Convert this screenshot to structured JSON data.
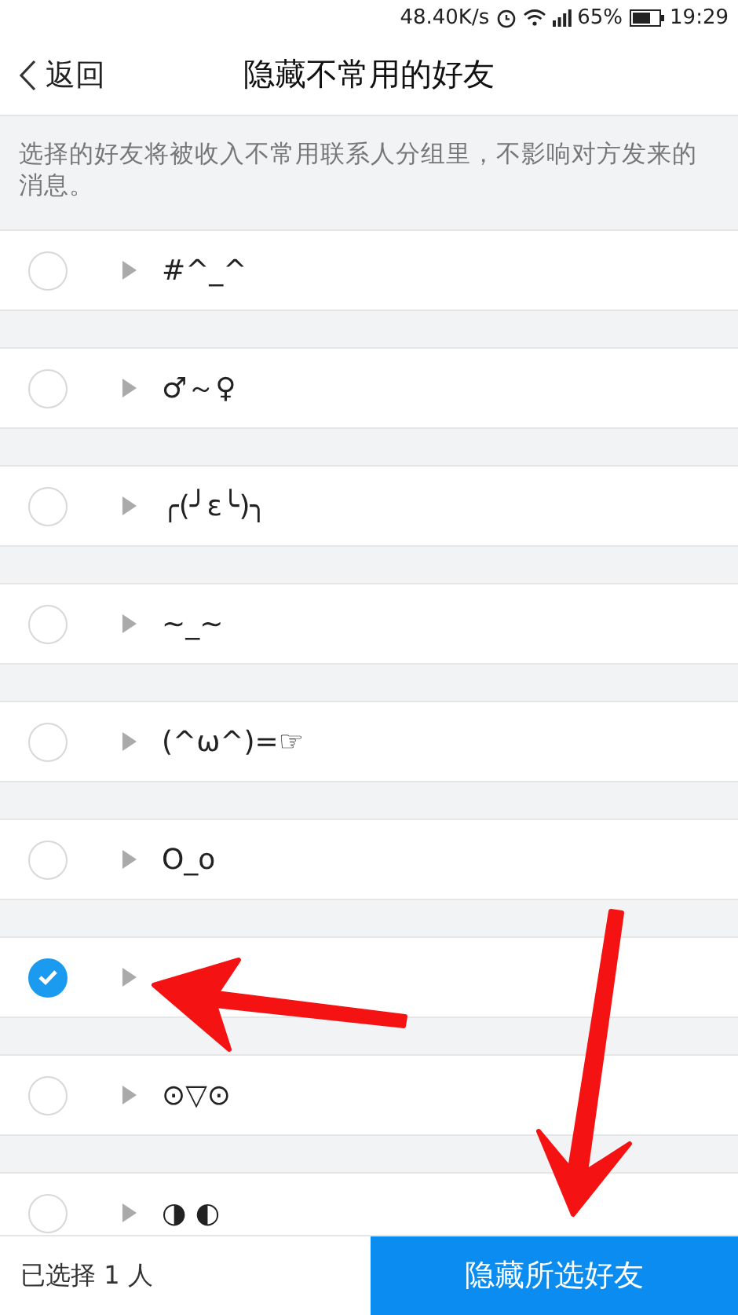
{
  "status_bar": {
    "speed": "48.40K/s",
    "battery": "65%",
    "time": "19:29"
  },
  "nav": {
    "back": "返回",
    "title": "隐藏不常用的好友"
  },
  "description": "选择的好友将被收入不常用联系人分组里，不影响对方发来的消息。",
  "friends": [
    {
      "name": "#^_^",
      "selected": false
    },
    {
      "name": "♂～♀",
      "selected": false
    },
    {
      "name": "╭(╯ε╰)╮",
      "selected": false
    },
    {
      "name": "~_~",
      "selected": false
    },
    {
      "name": "(^ω^)=☞",
      "selected": false
    },
    {
      "name": "O_o",
      "selected": false
    },
    {
      "selected": true
    },
    {
      "name": "⊙▽⊙",
      "selected": false
    },
    {
      "name": "◑ ◐",
      "selected": false
    }
  ],
  "bottom_bar": {
    "count": "已选择 1 人",
    "button": "隐藏所选好友"
  }
}
